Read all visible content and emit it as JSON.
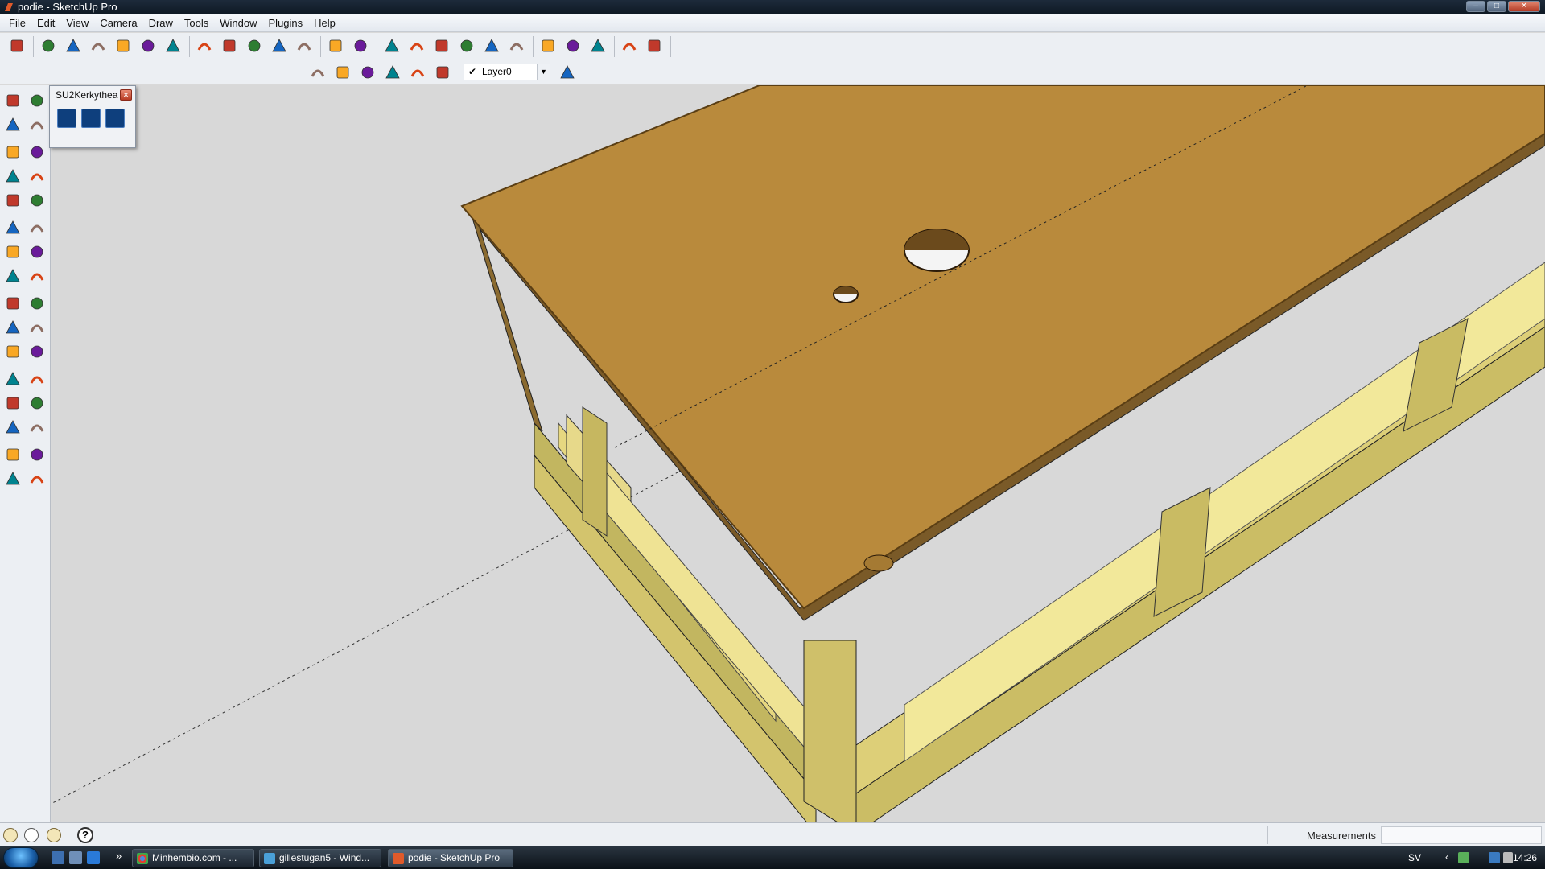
{
  "window": {
    "title": "podie - SketchUp Pro",
    "controls": {
      "minimize": "–",
      "maximize": "□",
      "close": "✕"
    }
  },
  "menu": [
    "File",
    "Edit",
    "View",
    "Camera",
    "Draw",
    "Tools",
    "Window",
    "Plugins",
    "Help"
  ],
  "toolbar_main_icons": [
    "select-icon",
    "pencil-icon",
    "rectangle-icon",
    "circle-icon",
    "arc-icon",
    "make-component-icon",
    "eraser-icon",
    "tape-measure-icon",
    "paint-bucket-icon",
    "push-pull-icon",
    "move-icon",
    "rotate-icon",
    "offset-icon",
    "orbit-icon",
    "pan-icon",
    "zoom-icon",
    "zoom-extents-icon",
    "previous-view-icon",
    "next-view-icon",
    "get-models-icon",
    "share-model-icon",
    "google-earth-icon",
    "get-photo-texture-icon",
    "place-model-icon",
    "toggle-terrain-icon"
  ],
  "toolbar_views_icons": [
    "iso-view-icon",
    "front-view-icon",
    "top-view-icon",
    "right-view-icon",
    "back-view-icon",
    "left-view-icon"
  ],
  "layer": {
    "current": "Layer0",
    "manager_icon": "layer-manager-icon"
  },
  "plugin_panel": {
    "title": "SU2Kerkythea"
  },
  "statusbar": {
    "measurements_label": "Measurements",
    "measurements_value": ""
  },
  "taskbar": {
    "tasks": [
      {
        "label": "Minhembio.com - ...",
        "icon": "chrome-icon"
      },
      {
        "label": "gillestugan5 - Wind...",
        "icon": "photo-viewer-icon"
      },
      {
        "label": "podie - SketchUp Pro",
        "icon": "sketchup-icon"
      }
    ],
    "more": "»",
    "language": "SV",
    "clock": "14:26"
  },
  "colors": {
    "board_top": "#b98a3c",
    "frame_wood": "#d2c46c",
    "viewport_bg": "#d8d8d8"
  }
}
